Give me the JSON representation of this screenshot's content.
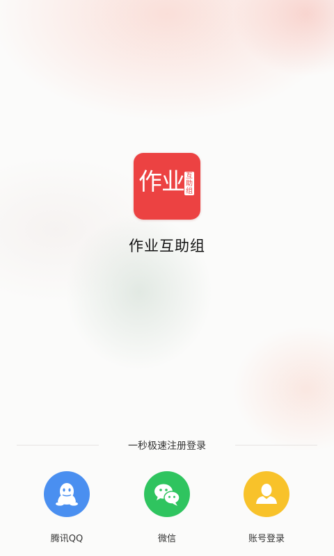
{
  "app": {
    "logo_main_text": "作业",
    "logo_tag_text": "互助组",
    "name": "作业互助组"
  },
  "login": {
    "quick_title": "一秒极速注册登录",
    "options": [
      {
        "label": "腾讯QQ",
        "icon": "qq-penguin-icon",
        "color": "#4a8ff0"
      },
      {
        "label": "微信",
        "icon": "wechat-chat-bubbles-icon",
        "color": "#2fc45f"
      },
      {
        "label": "账号登录",
        "icon": "user-silhouette-icon",
        "color": "#f8c22a"
      }
    ]
  },
  "colors": {
    "logo_red": "#ec4242",
    "text_dark": "#111111"
  }
}
